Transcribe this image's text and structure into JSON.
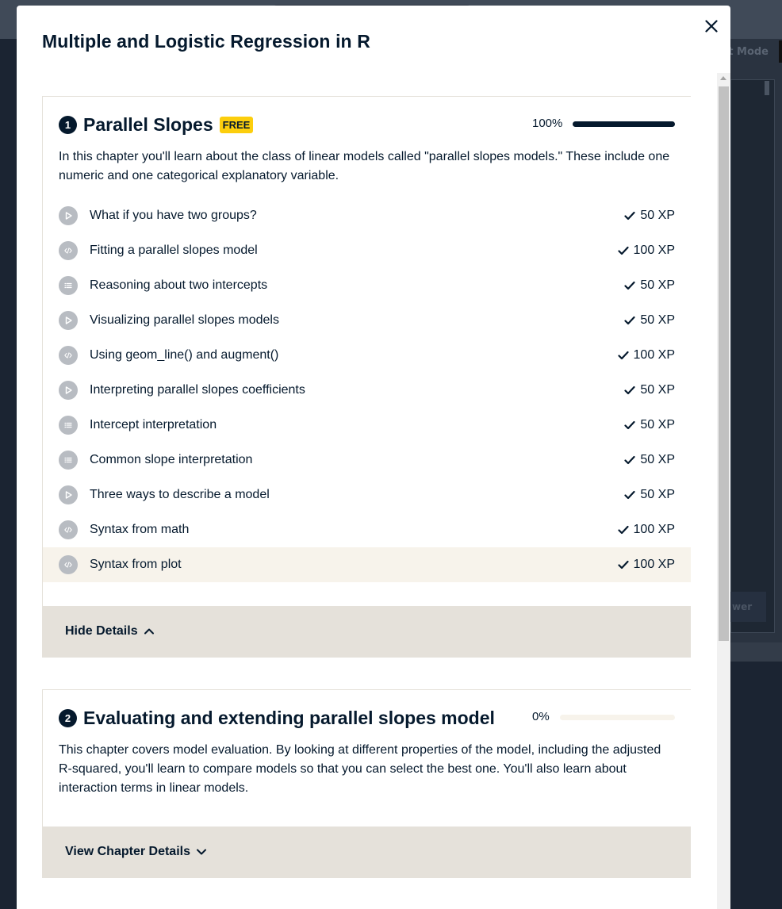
{
  "background": {
    "mode_label": "t Mode",
    "button_label": "wer"
  },
  "modal": {
    "title": "Multiple and Logistic Regression in R",
    "close_icon": "close-icon"
  },
  "chapters": [
    {
      "number": "1",
      "title": "Parallel Slopes",
      "badge": "FREE",
      "progress_label": "100%",
      "progress": 1.0,
      "description": "In this chapter you'll learn about the class of linear models called \"parallel slopes models.\" These include one numeric and one categorical explanatory variable.",
      "lessons": [
        {
          "type": "video",
          "title": "What if you have two groups?",
          "xp": "50 XP"
        },
        {
          "type": "code",
          "title": "Fitting a parallel slopes model",
          "xp": "100 XP"
        },
        {
          "type": "mc",
          "title": "Reasoning about two intercepts",
          "xp": "50 XP"
        },
        {
          "type": "video",
          "title": "Visualizing parallel slopes models",
          "xp": "50 XP"
        },
        {
          "type": "code",
          "title": "Using geom_line() and augment()",
          "xp": "100 XP"
        },
        {
          "type": "video",
          "title": "Interpreting parallel slopes coefficients",
          "xp": "50 XP"
        },
        {
          "type": "mc",
          "title": "Intercept interpretation",
          "xp": "50 XP"
        },
        {
          "type": "mc",
          "title": "Common slope interpretation",
          "xp": "50 XP"
        },
        {
          "type": "video",
          "title": "Three ways to describe a model",
          "xp": "50 XP"
        },
        {
          "type": "code",
          "title": "Syntax from math",
          "xp": "100 XP"
        },
        {
          "type": "code",
          "title": "Syntax from plot",
          "xp": "100 XP",
          "active": true
        }
      ],
      "toggle_label": "Hide Details"
    },
    {
      "number": "2",
      "title": "Evaluating and extending parallel slopes model",
      "progress_label": "0%",
      "progress": 0.0,
      "description": "This chapter covers model evaluation. By looking at different properties of the model, including the adjusted R-squared, you'll learn to compare models so that you can select the best one. You'll also learn about interaction terms in linear models.",
      "toggle_label": "View Chapter Details"
    }
  ],
  "colors": {
    "navy": "#05192d",
    "free_badge": "#fcce0d",
    "active_row": "#f7f3eb",
    "toggle_bg": "#e5e1da"
  }
}
